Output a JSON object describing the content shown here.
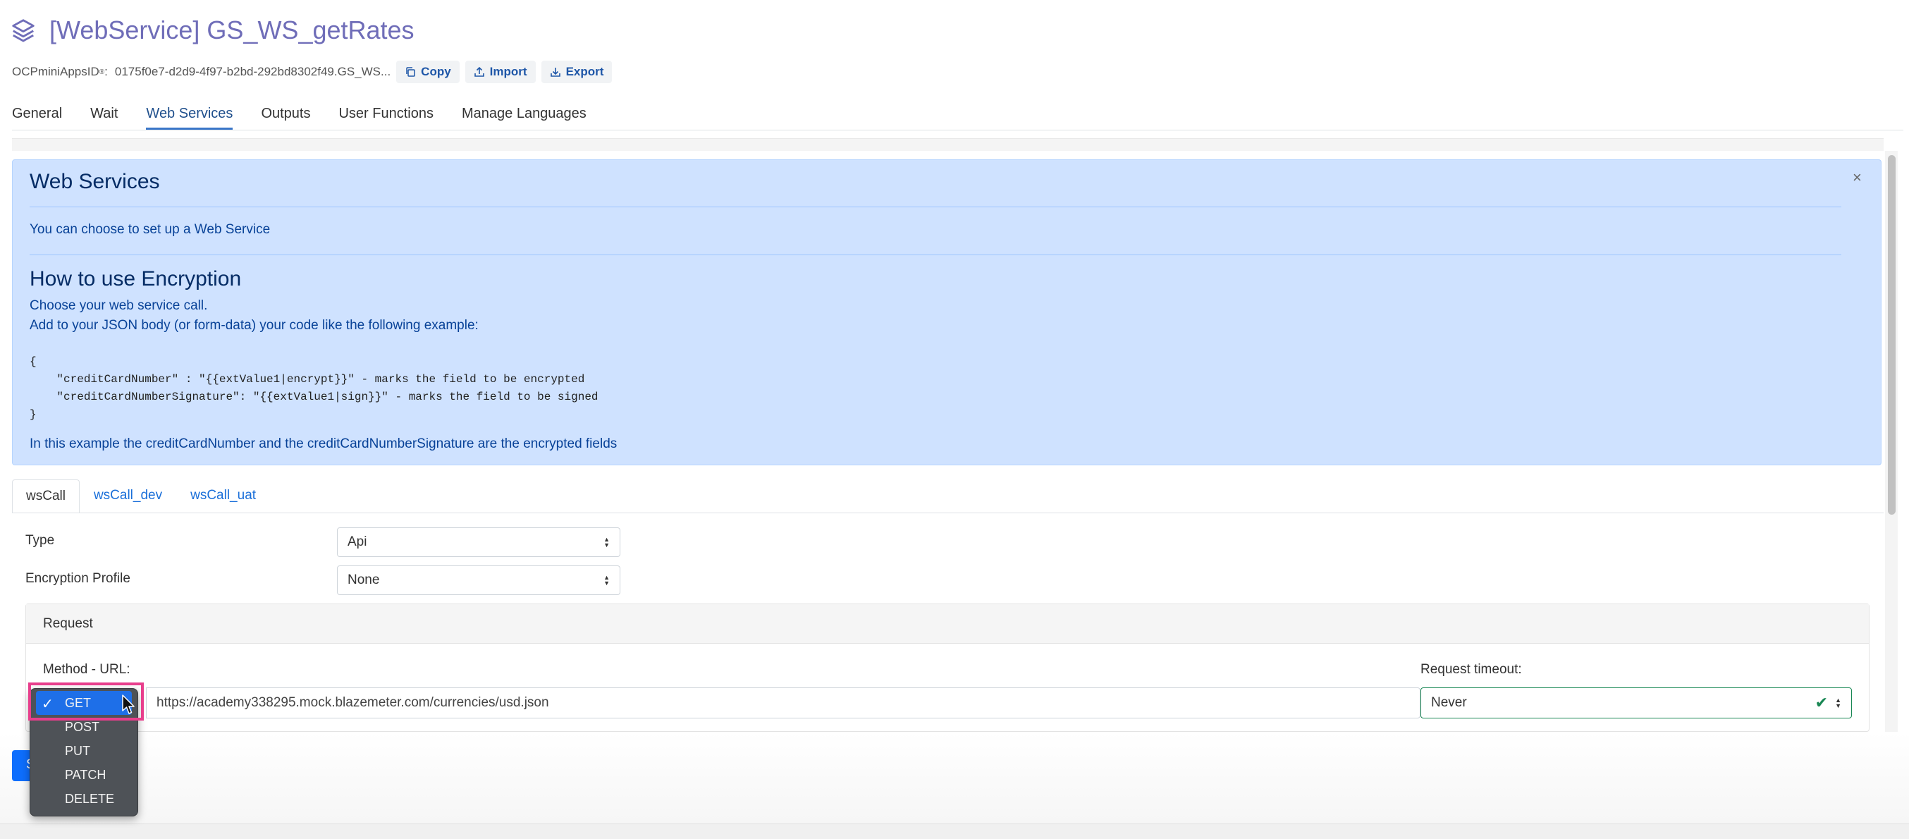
{
  "header": {
    "title": "[WebService] GS_WS_getRates",
    "app_id_label": "OCPminiAppsID",
    "app_id_sup": "®",
    "app_id_suffix": ":",
    "app_id_value": "0175f0e7-d2d9-4f97-b2bd-292bd8302f49.GS_WS...",
    "buttons": {
      "copy": "Copy",
      "import": "Import",
      "export": "Export"
    }
  },
  "main_tabs": [
    "General",
    "Wait",
    "Web Services",
    "Outputs",
    "User Functions",
    "Manage Languages"
  ],
  "active_main_tab": "Web Services",
  "alert": {
    "title": "Web Services",
    "text": "You can choose to set up a Web Service",
    "title2": "How to use Encryption",
    "line1": "Choose your web service call.",
    "line2": "Add to your JSON body (or form-data) your code like the following example:",
    "code": "{\n    \"creditCardNumber\" : \"{{extValue1|encrypt}}\" - marks the field to be encrypted\n    \"creditCardNumberSignature\": \"{{extValue1|sign}}\" - marks the field to be signed\n}",
    "footer": "In this example the creditCardNumber and the creditCardNumberSignature are the encrypted fields",
    "close": "×"
  },
  "sub_tabs": [
    "wsCall",
    "wsCall_dev",
    "wsCall_uat"
  ],
  "form": {
    "type_label": "Type",
    "type_value": "Api",
    "encryption_label": "Encryption Profile",
    "encryption_value": "None"
  },
  "request": {
    "header": "Request",
    "method_url_label": "Method - URL:",
    "url_value": "https://academy338295.mock.blazemeter.com/currencies/usd.json",
    "timeout_label": "Request timeout:",
    "timeout_value": "Never"
  },
  "save_button": "S",
  "method_dropdown": {
    "selected": "GET",
    "options": [
      "GET",
      "POST",
      "PUT",
      "PATCH",
      "DELETE"
    ]
  },
  "colors": {
    "title": "#6f6db8",
    "link": "#1a6fd9",
    "alert_bg": "#cfe2ff",
    "highlight": "#e83e8c",
    "selected_option": "#1e6fe8"
  }
}
